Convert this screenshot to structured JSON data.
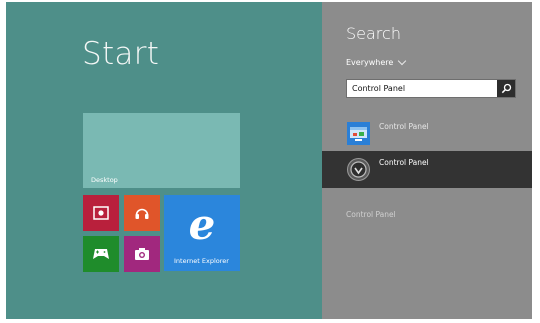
{
  "start": {
    "title": "Start",
    "tiles": {
      "desktop": "Desktop",
      "internet_explorer": "Internet Explorer"
    }
  },
  "search": {
    "title": "Search",
    "scope": "Everywhere",
    "query": "Control Panel",
    "results": [
      {
        "label": "Control Panel",
        "icon": "control-panel-icon"
      },
      {
        "label": "Control Panel",
        "icon": "power-settings-icon"
      }
    ],
    "more_result": "Control Panel"
  },
  "colors": {
    "start_background": "#4e8f89",
    "charm_background": "#8c8c8c",
    "selected_result": "#333333",
    "desktop_tile": "#7ab9b3",
    "video_tile": "#b9203c",
    "music_tile": "#e0552a",
    "games_tile": "#1f8c2b",
    "camera_tile": "#a1287e",
    "ie_tile": "#2b86dc"
  }
}
